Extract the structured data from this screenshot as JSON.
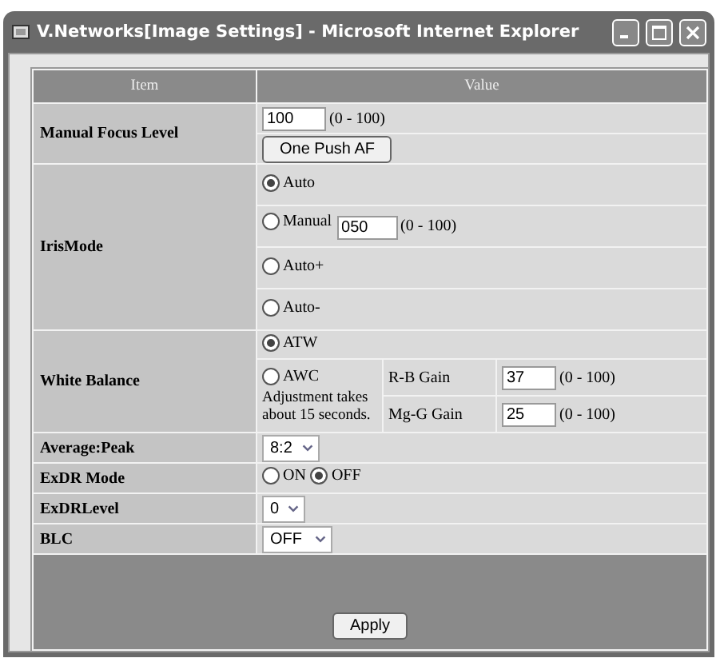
{
  "window": {
    "title": "V.Networks[Image Settings] - Microsoft Internet Explorer"
  },
  "table": {
    "columns": [
      "Item",
      "Value"
    ],
    "manual_focus": {
      "label": "Manual Focus Level",
      "value": "100",
      "range": "(0 - 100)",
      "button": "One Push AF"
    },
    "iris": {
      "label": "IrisMode",
      "options": [
        {
          "label": "Auto",
          "selected": true
        },
        {
          "label": "Manual",
          "selected": false,
          "value": "050",
          "range": "(0 - 100)"
        },
        {
          "label": "Auto+",
          "selected": false
        },
        {
          "label": "Auto-",
          "selected": false
        }
      ]
    },
    "white_balance": {
      "label": "White Balance",
      "options": [
        {
          "label": "ATW",
          "selected": true
        },
        {
          "label": "AWC",
          "selected": false,
          "note": "Adjustment takes about 15 seconds."
        }
      ],
      "gains": [
        {
          "label": "R-B Gain",
          "value": "37",
          "range": "(0 - 100)"
        },
        {
          "label": "Mg-G Gain",
          "value": "25",
          "range": "(0 - 100)"
        }
      ]
    },
    "average_peak": {
      "label": "Average:Peak",
      "value": "8:2"
    },
    "exdr_mode": {
      "label": "ExDR Mode",
      "options": [
        {
          "label": "ON",
          "selected": false
        },
        {
          "label": "OFF",
          "selected": true
        }
      ]
    },
    "exdr_level": {
      "label": "ExDRLevel",
      "value": "0"
    },
    "blc": {
      "label": "BLC",
      "value": "OFF"
    },
    "apply": "Apply"
  }
}
